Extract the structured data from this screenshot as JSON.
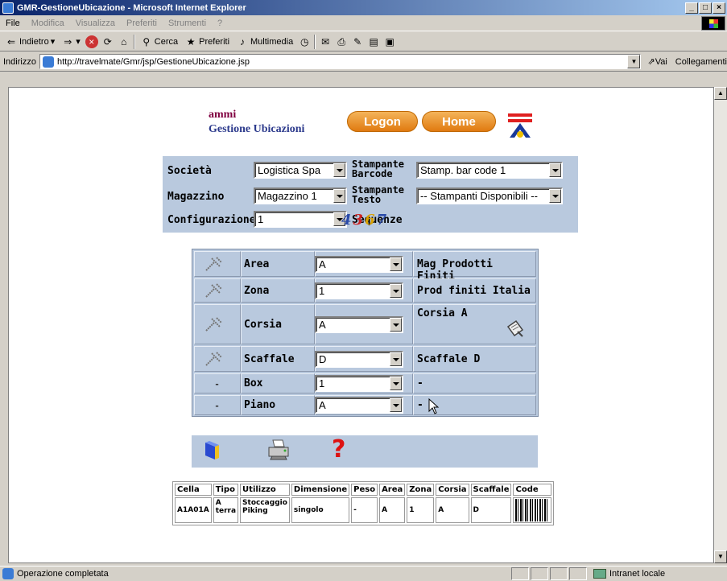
{
  "window": {
    "title": "GMR-GestioneUbicazione - Microsoft Internet Explorer",
    "controls": [
      "_",
      "□",
      "×"
    ]
  },
  "menubar": {
    "items": [
      "File",
      "Modifica",
      "Visualizza",
      "Preferiti",
      "Strumenti",
      "?"
    ]
  },
  "toolbar": {
    "back": "Indietro",
    "search": "Cerca",
    "favorites": "Preferiti",
    "multimedia": "Multimedia"
  },
  "addressbar": {
    "label": "Indirizzo",
    "url": "http://travelmate/Gmr/jsp/GestioneUbicazione.jsp",
    "go": "Vai",
    "links": "Collegamenti"
  },
  "page": {
    "user": "ammi",
    "app_title": "Gestione Ubicazioni",
    "logon": "Logon",
    "home": "Home",
    "filters": {
      "societa_label": "Società",
      "societa_value": "Logistica Spa",
      "magazzino_label": "Magazzino",
      "magazzino_value": "Magazzino 1",
      "configurazione_label": "Configurazione",
      "configurazione_value": "1",
      "stampante_barcode_label_1": "Stampante",
      "stampante_barcode_label_2": "Barcode",
      "stampante_barcode_value": "Stamp. bar code 1",
      "stampante_testo_label_1": "Stampante",
      "stampante_testo_label_2": "Testo",
      "stampante_testo_value": "-- Stampanti Disponibili --",
      "sequenze_label": "Sequenze",
      "sequence_glyphs": [
        "4",
        "3",
        "6",
        "7"
      ]
    },
    "location_rows": [
      {
        "label": "Area",
        "value": "A",
        "desc": "Mag Prodotti Finiti",
        "icon": "tools-icon"
      },
      {
        "label": "Zona",
        "value": "1",
        "desc": "Prod finiti Italia",
        "icon": "tools-icon"
      },
      {
        "label": "Corsia",
        "value": "A",
        "desc": "Corsia A",
        "icon": "tools-icon"
      },
      {
        "label": "Scaffale",
        "value": "D",
        "desc": "Scaffale D",
        "icon": "tools-icon"
      },
      {
        "label": "Box",
        "value": "1",
        "desc": "-",
        "icon": "-"
      },
      {
        "label": "Piano",
        "value": "A",
        "desc": "-",
        "icon": "-"
      }
    ],
    "cells_table": {
      "headers": [
        "Cella",
        "Tipo",
        "Utilizzo",
        "Dimensione",
        "Peso",
        "Area",
        "Zona",
        "Corsia",
        "Scaffale",
        "Code"
      ],
      "row": {
        "cella": "A1A01A",
        "tipo_1": "A",
        "tipo_2": "terra",
        "utilizzo_1": "Stoccaggio",
        "utilizzo_2": "Piking",
        "dimensione": "singolo",
        "peso": "-",
        "area": "A",
        "zona": "1",
        "corsia": "A",
        "scaffale": "D"
      }
    }
  },
  "statusbar": {
    "text": "Operazione completata",
    "zone": "Intranet locale"
  }
}
